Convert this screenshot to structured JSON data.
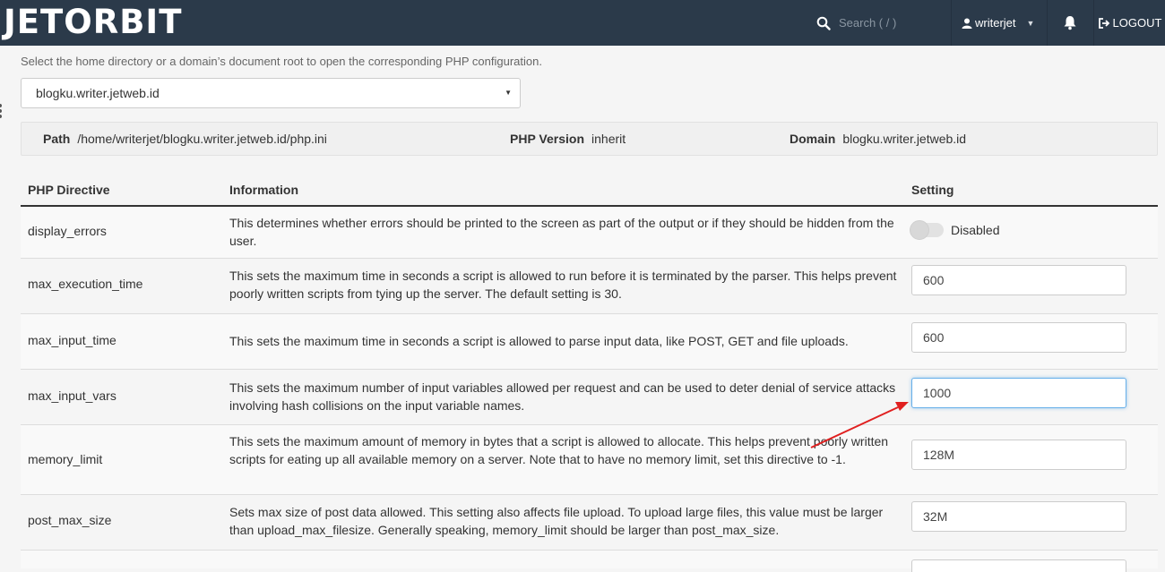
{
  "header": {
    "logo_text": "JETORBIT",
    "search_placeholder": "Search ( / )",
    "username": "writerjet",
    "logout_label": "LOGOUT",
    "bg_color": "#2b3a4a"
  },
  "intro_text": "Select the home directory or a domain’s document root to open the corresponding PHP configuration.",
  "domain_select": {
    "value": "blogku.writer.jetweb.id"
  },
  "info_bar": {
    "path_label": "Path",
    "path_value": "/home/writerjet/blogku.writer.jetweb.id/php.ini",
    "version_label": "PHP Version",
    "version_value": "inherit",
    "domain_label": "Domain",
    "domain_value": "blogku.writer.jetweb.id"
  },
  "table": {
    "headers": {
      "directive": "PHP Directive",
      "information": "Information",
      "setting": "Setting"
    },
    "rows": [
      {
        "directive": "display_errors",
        "info": "This determines whether errors should be printed to the screen as part of the output or if they should be hidden from the user.",
        "type": "toggle",
        "value": "Disabled"
      },
      {
        "directive": "max_execution_time",
        "info": "This sets the maximum time in seconds a script is allowed to run before it is terminated by the parser. This helps prevent poorly written scripts from tying up the server. The default setting is 30.",
        "type": "input",
        "value": "600"
      },
      {
        "directive": "max_input_time",
        "info": "This sets the maximum time in seconds a script is allowed to parse input data, like POST, GET and file uploads.",
        "type": "input",
        "value": "600"
      },
      {
        "directive": "max_input_vars",
        "info": "This sets the maximum number of input variables allowed per request and can be used to deter denial of service attacks involving hash collisions on the input variable names.",
        "type": "input",
        "value": "1000"
      },
      {
        "directive": "memory_limit",
        "info": "This sets the maximum amount of memory in bytes that a script is allowed to allocate. This helps prevent poorly written scripts for eating up all available memory on a server. Note that to have no memory limit, set this directive to -1.",
        "type": "input",
        "value": "128M"
      },
      {
        "directive": "post_max_size",
        "info": "Sets max size of post data allowed. This setting also affects file upload. To upload large files, this value must be larger than upload_max_filesize. Generally speaking, memory_limit should be larger than post_max_size.",
        "type": "input",
        "value": "32M"
      }
    ]
  },
  "annotation_color": "#e02020"
}
